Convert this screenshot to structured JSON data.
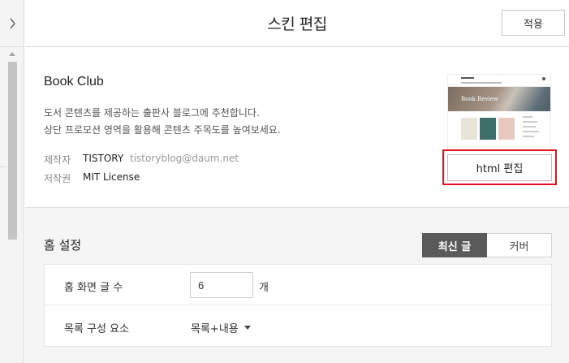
{
  "header": {
    "title": "스킨 편집",
    "apply_label": "적용"
  },
  "skin": {
    "name": "Book Club",
    "description_line1": "도서 콘텐츠를 제공하는 출판사 블로그에 추천합니다.",
    "description_line2": "상단 프로모션 영역을 활용해 콘텐츠 주목도를 높여보세요.",
    "maker_label": "제작자",
    "maker_name": "TISTORY",
    "maker_email": "tistoryblog@daum.net",
    "license_label": "저작권",
    "license_value": "MIT License",
    "thumbnail_title": "Book Review",
    "html_edit_label": "html 편집"
  },
  "home_settings": {
    "title": "홈 설정",
    "tabs": [
      {
        "label": "최신 글",
        "active": true
      },
      {
        "label": "커버",
        "active": false
      }
    ],
    "post_count_label": "홈 화면 글 수",
    "post_count_value": "6",
    "post_count_unit": "개",
    "list_components_label": "목록 구성 요소",
    "list_components_value": "목록+내용"
  },
  "colors": {
    "highlight": "#e2121d",
    "active_tab": "#5a5a5a"
  }
}
